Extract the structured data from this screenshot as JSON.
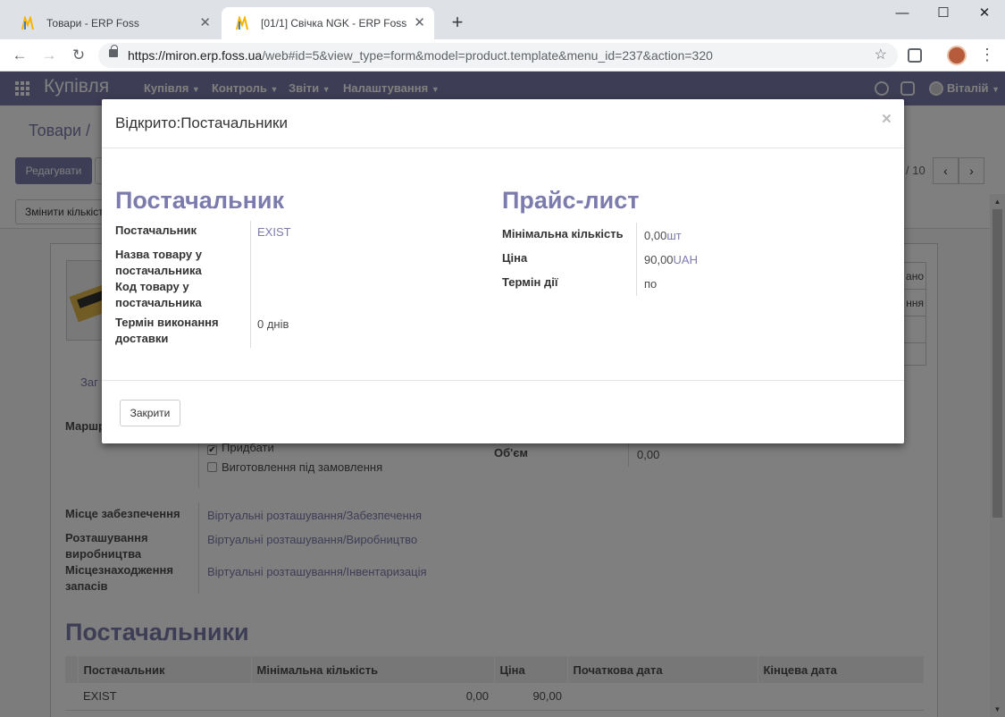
{
  "browser": {
    "tabs": [
      {
        "title": "Товари - ERP Foss",
        "active": false
      },
      {
        "title": "[01/1] Свічка NGK - ERP Foss",
        "active": true
      }
    ],
    "url_host": "https://miron.erp.foss.ua",
    "url_path": "/web#id=5&view_type=form&model=product.template&menu_id=237&action=320"
  },
  "navbar": {
    "app_name": "Купівля",
    "menus": [
      "Купівля",
      "Контроль",
      "Звіти",
      "Налаштування"
    ],
    "user": "Віталій"
  },
  "control_panel": {
    "breadcrumb": "Товари /",
    "edit_button": "Редагувати",
    "pager": "/ 10",
    "status_button": "Змінити кількість"
  },
  "background": {
    "tab_label": "Заг",
    "side_values": [
      "ано",
      "ння"
    ],
    "routes_label": "Маршр",
    "route_buy": "Придбати",
    "route_mto": "Виготовлення під замовлення",
    "volume_label": "Об'єм",
    "volume_value": "0,00",
    "locations": [
      {
        "label": "Місце забезпечення",
        "value": "Віртуальні розташування/Забезпечення"
      },
      {
        "label": "Розташування виробництва",
        "value": "Віртуальні розташування/Виробництво"
      },
      {
        "label": "Місцезнаходження запасів",
        "value": "Віртуальні розташування/Інвентаризація"
      }
    ],
    "suppliers_title": "Постачальники",
    "table": {
      "headers": [
        "Постачальник",
        "Мінімальна кількість",
        "Ціна",
        "Початкова дата",
        "Кінцева дата"
      ],
      "rows": [
        {
          "supplier": "EXIST",
          "min_qty": "0,00",
          "price": "90,00",
          "start": "",
          "end": ""
        }
      ]
    }
  },
  "modal": {
    "title": "Відкрито:Постачальники",
    "supplier_group": {
      "heading": "Постачальник",
      "supplier_label": "Постачальник",
      "supplier_value": "EXIST",
      "product_name_label": "Назва товару у постачальника",
      "product_code_label": "Код товару у постачальника",
      "lead_time_label": "Термін виконання доставки",
      "lead_time_value": "0 днів"
    },
    "pricelist_group": {
      "heading": "Прайс-лист",
      "min_qty_label": "Мінімальна кількість",
      "min_qty_value": "0,00",
      "min_qty_uom": "шт",
      "price_label": "Ціна",
      "price_value": "90,00",
      "currency": "UAH",
      "validity_label": "Термін дії",
      "validity_value": "по"
    },
    "close_button": "Закрити"
  }
}
